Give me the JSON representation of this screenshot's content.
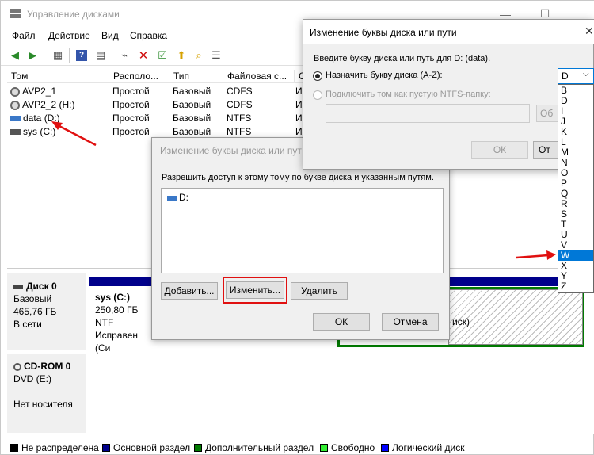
{
  "main_window": {
    "title": "Управление дисками",
    "menu": [
      "Файл",
      "Действие",
      "Вид",
      "Справка"
    ],
    "columns": [
      "Том",
      "Располо...",
      "Тип",
      "Файловая с...",
      "С"
    ],
    "volumes": [
      {
        "name": "AVP2_1",
        "layout": "Простой",
        "type": "Базовый",
        "fs": "CDFS",
        "status": "И",
        "icon": "cd-icon"
      },
      {
        "name": "AVP2_2 (H:)",
        "layout": "Простой",
        "type": "Базовый",
        "fs": "CDFS",
        "status": "И",
        "icon": "cd-icon"
      },
      {
        "name": "data (D:)",
        "layout": "Простой",
        "type": "Базовый",
        "fs": "NTFS",
        "status": "И",
        "icon": "hdd-icon"
      },
      {
        "name": "sys (C:)",
        "layout": "Простой",
        "type": "Базовый",
        "fs": "NTFS",
        "status": "И",
        "icon": "hdd-icon"
      }
    ],
    "disks": [
      {
        "name": "Диск 0",
        "kind": "Базовый",
        "size": "465,76 ГБ",
        "state": "В сети"
      },
      {
        "name": "CD-ROM 0",
        "kind": "DVD (E:)",
        "size": "",
        "state": "Нет носителя"
      }
    ],
    "sys_partition": {
      "name": "sys (C:)",
      "size": "250,80 ГБ NTF",
      "status": "Исправен (Си"
    },
    "ext_partition_text": "иск)",
    "legend": [
      {
        "label": "Не распределена",
        "color": "#000000"
      },
      {
        "label": "Основной раздел",
        "color": "#00008b"
      },
      {
        "label": "Дополнительный раздел",
        "color": "#007a00"
      },
      {
        "label": "Свободно",
        "color": "#33ee33"
      },
      {
        "label": "Логический диск",
        "color": "#0000ff"
      }
    ]
  },
  "dialog_change": {
    "title": "Изменение буквы диска или пут",
    "prompt": "Разрешить доступ к этому тому по букве диска и указанным путям.",
    "items": [
      "D:"
    ],
    "buttons": {
      "add": "Добавить...",
      "change": "Изменить...",
      "remove": "Удалить",
      "ok": "ОК",
      "cancel": "Отмена"
    }
  },
  "dialog_assign": {
    "title": "Изменение буквы диска или пути",
    "prompt": "Введите букву диска или путь для D: (data).",
    "option_assign": "Назначить букву диска (A-Z):",
    "option_mount": "Подключить том как пустую NTFS-папку:",
    "browse_label": "Об",
    "ok": "ОК",
    "cancel": "От",
    "selected_letter": "D",
    "letters": [
      "B",
      "D",
      "I",
      "J",
      "K",
      "L",
      "M",
      "N",
      "O",
      "P",
      "Q",
      "R",
      "S",
      "T",
      "U",
      "V",
      "W",
      "X",
      "Y",
      "Z"
    ],
    "highlighted_letter": "W"
  }
}
